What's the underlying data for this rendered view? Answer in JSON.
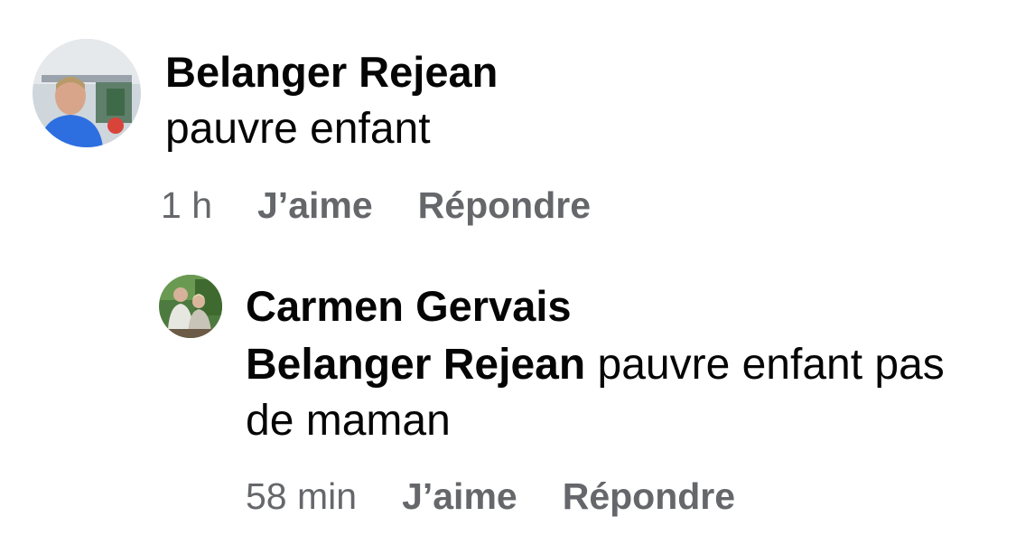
{
  "comments": [
    {
      "author": "Belanger Rejean",
      "text": "pauvre enfant",
      "time": "1 h",
      "like_label": "J’aime",
      "reply_label": "Répondre"
    }
  ],
  "reply": {
    "author": "Carmen Gervais",
    "mention": "Belanger Rejean",
    "text": " pauvre enfant pas de maman",
    "time": "58 min",
    "like_label": "J’aime",
    "reply_label": "Répondre"
  },
  "colors": {
    "text": "#050505",
    "meta": "#65676b",
    "background": "#ffffff"
  }
}
